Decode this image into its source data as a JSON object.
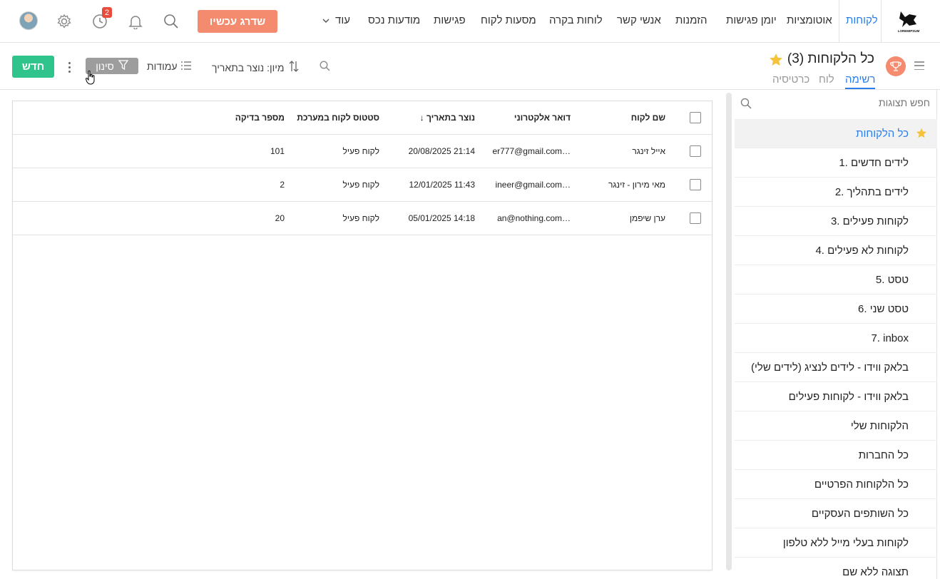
{
  "topnav": {
    "items": [
      {
        "label": "לקוחות",
        "active": true
      },
      {
        "label": "אוטומציות"
      },
      {
        "label": "יומן פגישות"
      },
      {
        "label": "הזמנות"
      },
      {
        "label": "אנשי קשר"
      },
      {
        "label": "לוחות בקרה"
      },
      {
        "label": "מסעות לקוח"
      },
      {
        "label": "פגישות"
      },
      {
        "label": "מודעות נכס"
      },
      {
        "label": "עוד"
      }
    ],
    "logo_text": "LOREMIPSUM",
    "upgrade_label": "שדרג עכשיו",
    "activity_badge": "2",
    "icons": [
      "search-icon",
      "bell-icon",
      "clock-icon",
      "gear-icon",
      "user-avatar"
    ],
    "colors": {
      "accent": "#2b7de9",
      "upgrade": "#f48b6e",
      "badge": "#e74c3c"
    }
  },
  "toolbar": {
    "title": "כל הלקוחות",
    "count": "(3)",
    "new_label": "חדש",
    "filter_label": "סינון",
    "columns_label": "עמודות",
    "sort_label": "מיון: נוצר בתאריך",
    "tabs": [
      {
        "label": "רשימה",
        "active": true
      },
      {
        "label": "לוח"
      },
      {
        "label": "כרטיסיה"
      }
    ],
    "colors": {
      "new": "#2ec48b",
      "filter": "#9d9d9d"
    }
  },
  "sidebar": {
    "search_placeholder": "חפש תצוגות",
    "items": [
      {
        "label": "כל הלקוחות",
        "active": true
      },
      {
        "label": "1. לידים חדשים"
      },
      {
        "label": "2. לידים בתהליך"
      },
      {
        "label": "3. לקוחות פעילים"
      },
      {
        "label": "4. לקוחות לא פעילים"
      },
      {
        "label": "5. טסט"
      },
      {
        "label": "6. טסט שני"
      },
      {
        "label": "7. inbox"
      },
      {
        "label": "בלאק ווידו - לידים לנציג (לידים שלי)"
      },
      {
        "label": "בלאק ווידו - לקוחות פעילים"
      },
      {
        "label": "הלקוחות שלי"
      },
      {
        "label": "כל החברות"
      },
      {
        "label": "כל הלקוחות הפרטיים"
      },
      {
        "label": "כל השותפים העסקיים"
      },
      {
        "label": "לקוחות בעלי מייל ללא טלפון"
      },
      {
        "label": "תצוגה ללא שם"
      }
    ]
  },
  "table": {
    "columns": [
      "שם לקוח",
      "דואר אלקטרוני",
      "↓ נוצר בתאריך",
      "סטטוס לקוח במערכת",
      "מספר בדיקה"
    ],
    "rows": [
      [
        "אייל זינגר",
        "er777@gmail.com…",
        "20/08/2025 21:14",
        "לקוח פעיל",
        "101"
      ],
      [
        "מאי מירון - זינגר",
        "ineer@gmail.com…",
        "12/01/2025 11:43",
        "לקוח פעיל",
        "2"
      ],
      [
        "ערן שיפמן",
        "an@nothing.com…",
        "05/01/2025 14:18",
        "לקוח פעיל",
        "20"
      ]
    ]
  }
}
